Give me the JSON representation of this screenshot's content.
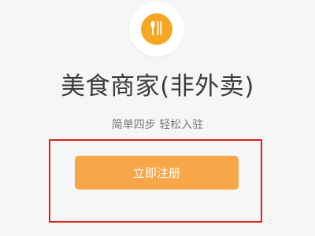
{
  "header": {
    "logo_icon": "utensils-icon",
    "brand_color": "#f5a623"
  },
  "main": {
    "title": "美食商家(非外卖)",
    "subtitle": "简单四步 轻松入驻",
    "register_label": "立即注册",
    "button_color": "#f7a748",
    "highlight_color": "#e02020"
  }
}
